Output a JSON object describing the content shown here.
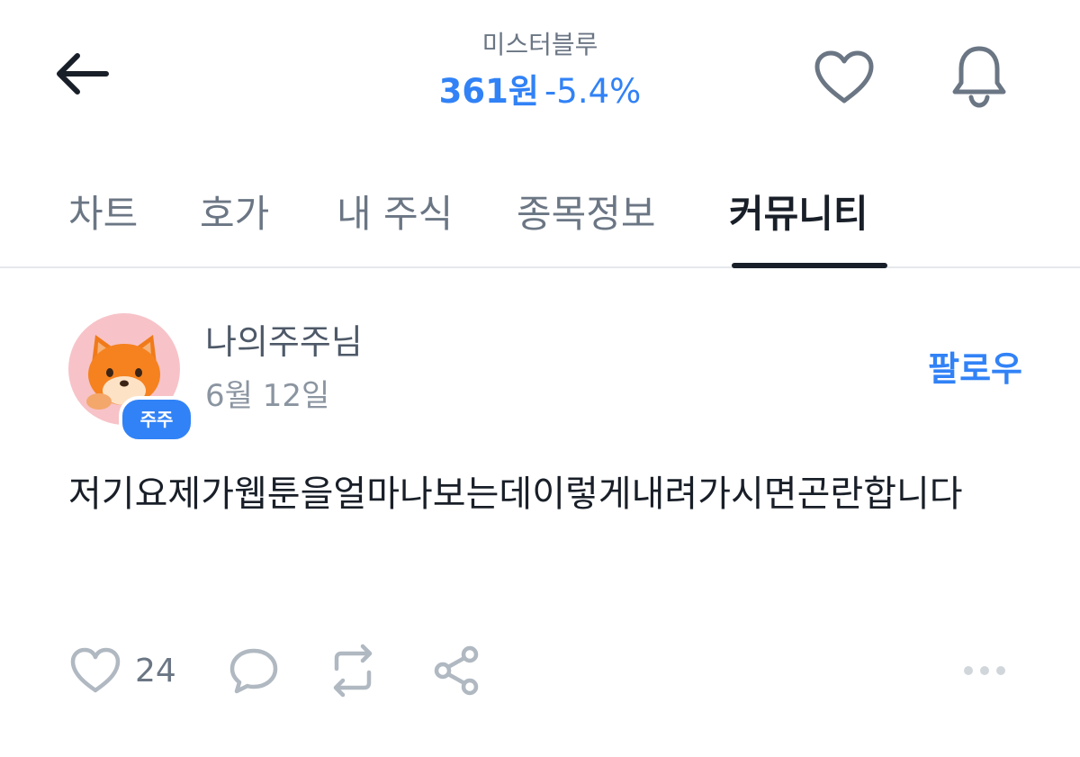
{
  "header": {
    "stock_name": "미스터블루",
    "price": "361원",
    "change": "-5.4%",
    "back_icon": "arrow-left-icon",
    "favorite_icon": "heart-outline-icon",
    "alert_icon": "bell-icon"
  },
  "tabs": [
    {
      "label": "차트",
      "active": false
    },
    {
      "label": "호가",
      "active": false
    },
    {
      "label": "내 주식",
      "active": false
    },
    {
      "label": "종목정보",
      "active": false
    },
    {
      "label": "커뮤니티",
      "active": true
    }
  ],
  "post": {
    "author": "나의주주님",
    "badge": "주주",
    "date": "6월 12일",
    "follow_label": "팔로우",
    "body": "저기요제가웹툰을얼마나보는데이렇게내려가시면곤란합니다",
    "avatar_icon": "fox-avatar-icon",
    "actions": {
      "like_count": "24",
      "like_icon": "heart-outline-icon",
      "comment_icon": "comment-bubble-icon",
      "repost_icon": "repost-icon",
      "share_icon": "share-icon",
      "more_icon": "more-dots-icon"
    }
  },
  "colors": {
    "accent": "#3182f6",
    "text_primary": "#191f28",
    "text_secondary": "#6b7684",
    "divider": "#e5e8eb",
    "avatar_bg": "#f7c3c8"
  }
}
